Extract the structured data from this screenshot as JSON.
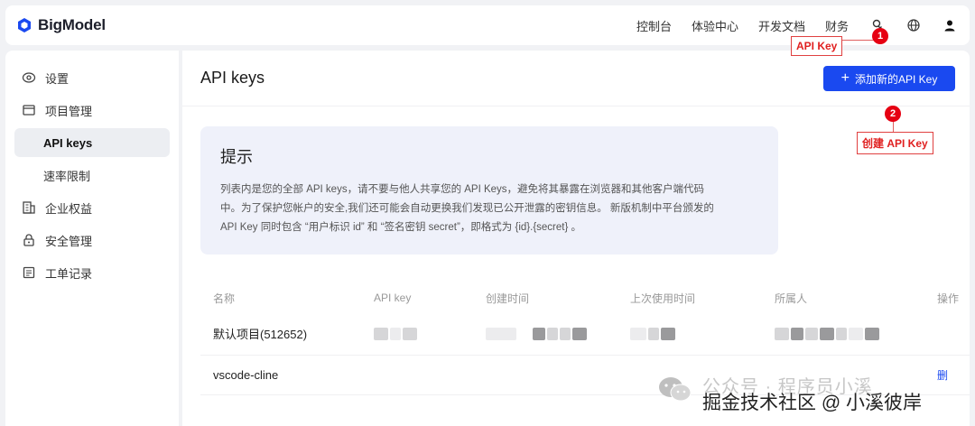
{
  "brand": {
    "name": "BigModel",
    "color": "#1a49f0"
  },
  "topnav": {
    "items": [
      "控制台",
      "体验中心",
      "开发文档",
      "财务"
    ]
  },
  "sidebar": {
    "items": [
      {
        "label": "设置",
        "icon": "eye-settings-icon"
      },
      {
        "label": "项目管理",
        "icon": "folder-icon"
      },
      {
        "label": "API keys",
        "active": true
      },
      {
        "label": "速率限制"
      },
      {
        "label": "企业权益",
        "icon": "building-icon"
      },
      {
        "label": "安全管理",
        "icon": "lock-icon"
      },
      {
        "label": "工单记录",
        "icon": "ticket-icon"
      }
    ]
  },
  "main": {
    "title": "API keys",
    "add_button": "添加新的API Key",
    "tip": {
      "title": "提示",
      "lines": [
        "列表内是您的全部 API keys，请不要与他人共享您的 API Keys，避免将其暴露在浏览器和其他客户端代码",
        "中。为了保护您帐户的安全,我们还可能会自动更换我们发现已公开泄露的密钥信息。 新版机制中平台颁发的",
        "API Key 同时包含 “用户标识 id” 和 “签名密钥 secret”，即格式为 {id}.{secret} 。"
      ]
    },
    "table": {
      "headers": [
        "名称",
        "API key",
        "创建时间",
        "上次使用时间",
        "所属人",
        "操作"
      ],
      "rows": [
        {
          "name": "默认项目(512652)"
        },
        {
          "name": "vscode-cline",
          "action": "删"
        }
      ]
    }
  },
  "annotations": {
    "callout1": "API Key",
    "marker1": "1",
    "callout2": "创建 API Key",
    "marker2": "2",
    "color": "#e60012"
  },
  "watermark": {
    "line1": "公众号 · 程序员小溪",
    "line2": "掘金技术社区 @ 小溪彼岸"
  }
}
